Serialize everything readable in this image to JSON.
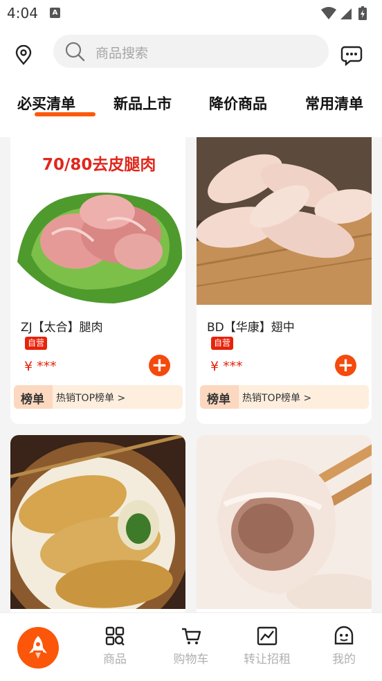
{
  "status_bar": {
    "time": "4:04",
    "notification_glyph": "A"
  },
  "search": {
    "placeholder": "商品搜索"
  },
  "tabs": [
    {
      "label": "必买清单",
      "active": true
    },
    {
      "label": "新品上市",
      "active": false
    },
    {
      "label": "降价商品",
      "active": false
    },
    {
      "label": "常用清单",
      "active": false
    }
  ],
  "products": [
    {
      "name": "ZJ【太合】腿肉",
      "badge": "自营",
      "price": "¥ ***",
      "image_caption": "70/80去皮腿肉",
      "rank_tag": "榜单",
      "rank_text": "热销TOP榜单 >"
    },
    {
      "name": "BD【华康】翅中",
      "badge": "自营",
      "price": "¥ ***",
      "rank_tag": "榜单",
      "rank_text": "热销TOP榜单 >"
    },
    {
      "name": "",
      "image": "pan-fried-dumplings"
    },
    {
      "name": "",
      "image": "dumpling-on-chopsticks"
    }
  ],
  "bottom_nav": [
    {
      "label": "",
      "icon": "rocket-icon"
    },
    {
      "label": "商品",
      "icon": "products-icon"
    },
    {
      "label": "购物车",
      "icon": "cart-icon"
    },
    {
      "label": "转让招租",
      "icon": "chart-icon"
    },
    {
      "label": "我的",
      "icon": "profile-icon"
    }
  ],
  "colors": {
    "accent": "#fb5a0c",
    "price": "#e8230b",
    "rank_bg": "#fdeede"
  }
}
